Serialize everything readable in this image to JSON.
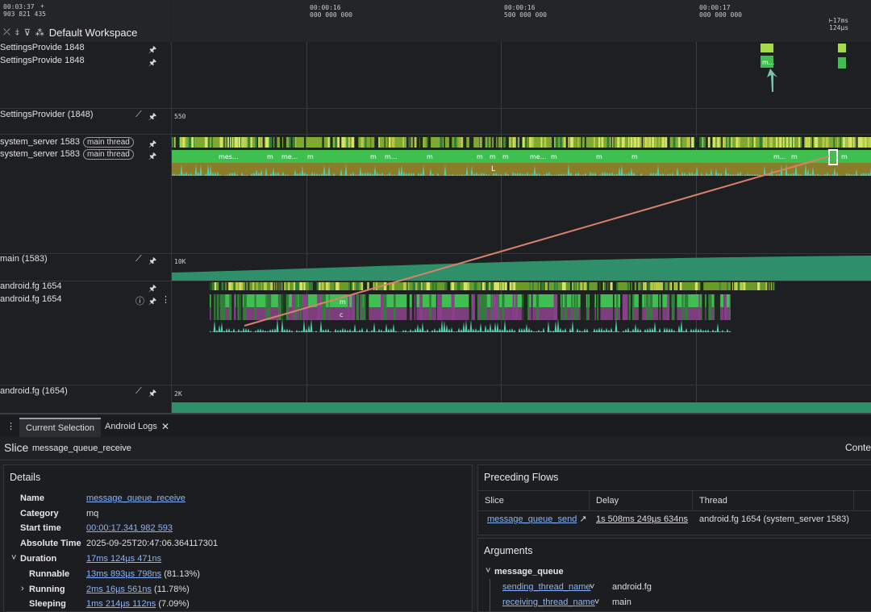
{
  "header": {
    "start_time": "00:03:37",
    "start_ns": "903 821 435",
    "plus_icon": "+",
    "workspace_title": "Default Workspace",
    "ticks": [
      {
        "t": "00:00:16",
        "ns": "000 000 000"
      },
      {
        "t": "00:00:16",
        "ns": "500 000 000"
      },
      {
        "t": "00:00:17",
        "ns": "000 000 000"
      }
    ],
    "span_label": "17ms 124µs",
    "icons": [
      "collapse-all-icon",
      "unpin-icon",
      "filter-icon",
      "workspace-icon"
    ]
  },
  "tracks": [
    {
      "name": "SettingsProvide 1848"
    },
    {
      "name": "SettingsProvide 1848"
    },
    {
      "name": "SettingsProvider (1848)",
      "counter": "550"
    },
    {
      "name": "system_server 1583",
      "tag": "main thread"
    },
    {
      "name": "system_server 1583",
      "tag": "main thread"
    },
    {
      "name": "main (1583)",
      "counter": "10K"
    },
    {
      "name": "android.fg 1654"
    },
    {
      "name": "android.fg 1654"
    },
    {
      "name": "android.fg (1654)",
      "counter": "2K"
    }
  ],
  "slice_labels": {
    "system_server": [
      "mes...",
      "m",
      "me...",
      "m",
      "m",
      "m...",
      "m",
      "m",
      "m",
      "m",
      "me...",
      "m",
      "m",
      "m",
      "m...",
      "m",
      "m"
    ],
    "android_fg": [
      "m",
      "c"
    ],
    "settings": "m...",
    "flow_marker": "L"
  },
  "tabs": [
    {
      "label": "Current Selection",
      "active": true
    },
    {
      "label": "Android Logs",
      "active": false
    }
  ],
  "tab_close": "✕",
  "tab_menu": "⋮",
  "slice": {
    "kind": "Slice",
    "name": "message_queue_receive",
    "right_label": "Conte"
  },
  "details": {
    "title": "Details",
    "rows": [
      {
        "key": "Name",
        "value": "message_queue_receive",
        "link": true
      },
      {
        "key": "Category",
        "value": "mq",
        "link": false
      },
      {
        "key": "Start time",
        "value": "00:00:17.341 982 593",
        "link": true
      },
      {
        "key": "Absolute Time",
        "value": "2025-09-25T20:47:06.364117301",
        "link": false
      },
      {
        "key": "Duration",
        "value": "17ms 124µs 471ns",
        "link": true
      },
      {
        "key": "Runnable",
        "value": "13ms 893µs 798ns",
        "pct": "(81.13%)",
        "link": true
      },
      {
        "key": "Running",
        "value": "2ms 16µs 561ns",
        "pct": "(11.78%)",
        "link": true
      },
      {
        "key": "Sleeping",
        "value": "1ms 214µs 112ns",
        "pct": "(7.09%)",
        "link": true
      }
    ]
  },
  "flows": {
    "title": "Preceding Flows",
    "headers": [
      "Slice",
      "Delay",
      "Thread"
    ],
    "row": {
      "slice": "message_queue_send",
      "delay": "1s 508ms 249µs 634ns",
      "thread": "android.fg 1654 (system_server 1583)"
    }
  },
  "arguments": {
    "title": "Arguments",
    "group": "message_queue",
    "items": [
      {
        "key": "sending_thread_name",
        "value": "android.fg"
      },
      {
        "key": "receiving_thread_name",
        "value": "main"
      }
    ]
  },
  "colors": {
    "slice_green": "#3fbf50",
    "slice_lime": "#a8d94a",
    "counter_teal": "#2fa57a",
    "flow_arrow": "#d9826a",
    "link": "#8ab4f8"
  }
}
